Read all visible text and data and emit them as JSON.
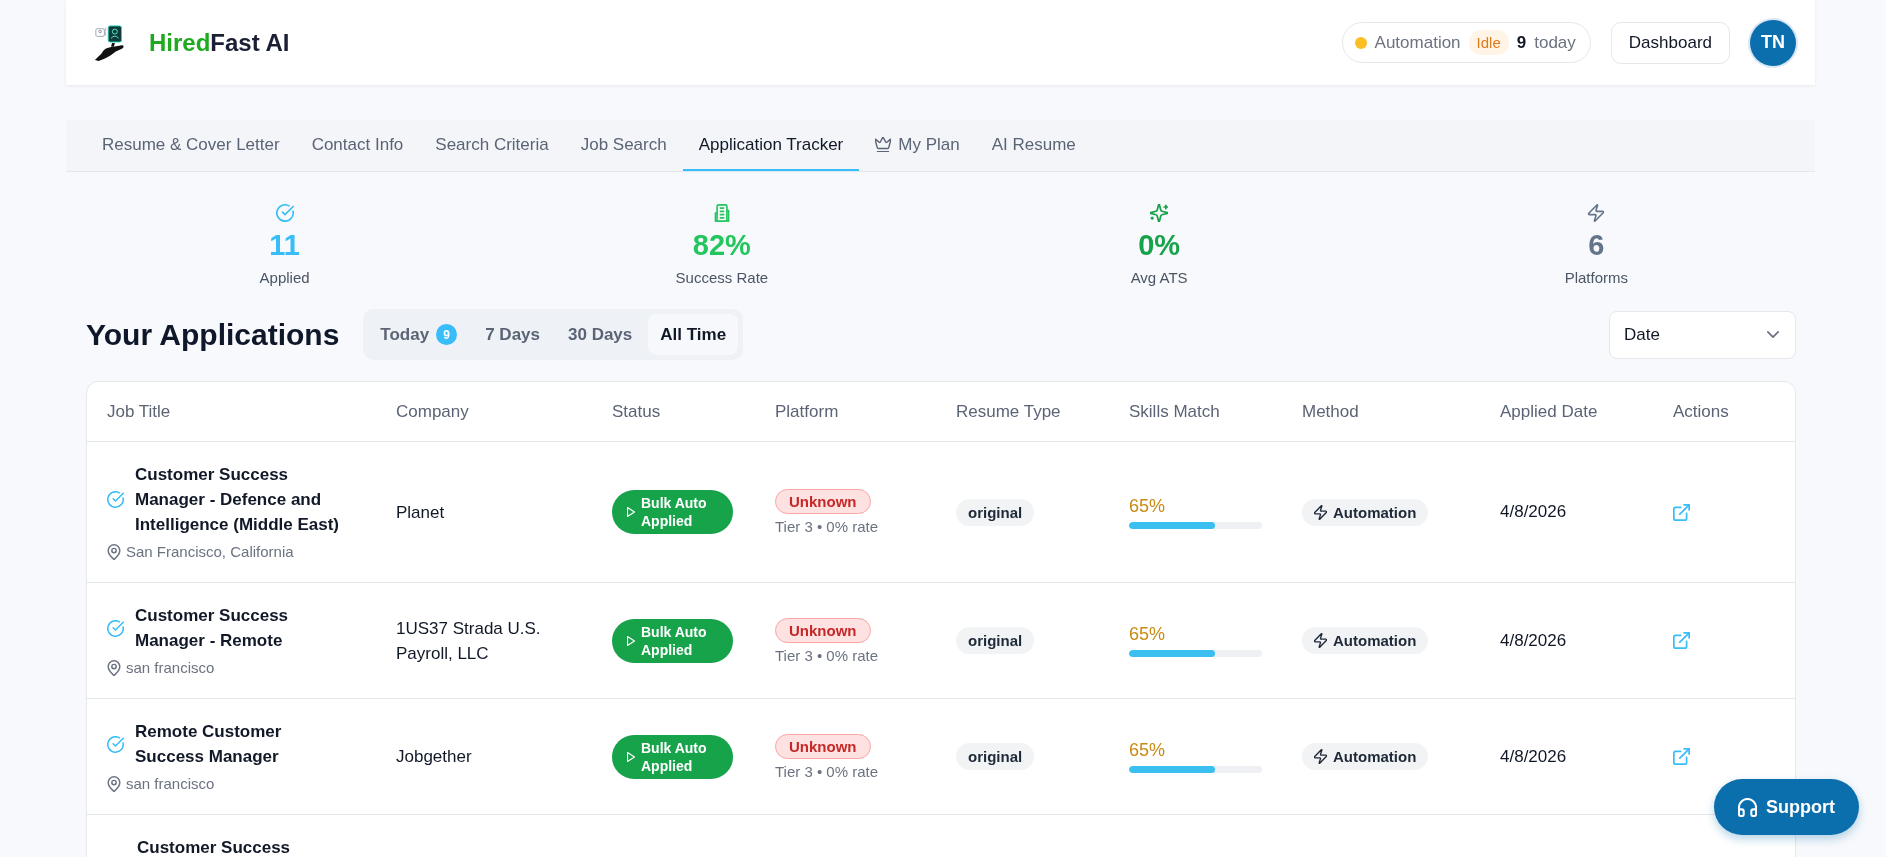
{
  "header": {
    "brand": {
      "lead": "Hired",
      "rest": "Fast AI"
    },
    "automation": {
      "label": "Automation",
      "status": "Idle",
      "count": "9",
      "count_label": "today"
    },
    "dashboard_button": "Dashboard",
    "avatar_initials": "TN"
  },
  "tabs": [
    {
      "label": "Resume & Cover Letter",
      "kind": "plain",
      "selected": false
    },
    {
      "label": "Contact Info",
      "kind": "plain",
      "selected": false
    },
    {
      "label": "Search Criteria",
      "kind": "plain",
      "selected": false
    },
    {
      "label": "Job Search",
      "kind": "plain",
      "selected": false
    },
    {
      "label": "Application Tracker",
      "kind": "plain",
      "selected": true
    },
    {
      "label": "My Plan",
      "kind": "icon",
      "selected": false
    },
    {
      "label": "AI Resume",
      "kind": "plain",
      "selected": false
    }
  ],
  "stats": [
    {
      "value": "11",
      "label": "Applied",
      "color": "#38bdf8"
    },
    {
      "value": "82%",
      "label": "Success Rate",
      "color": "#22c55e"
    },
    {
      "value": "0%",
      "label": "Avg ATS",
      "color": "#16a34a"
    },
    {
      "value": "6",
      "label": "Platforms",
      "color": "#64748b"
    }
  ],
  "applications": {
    "title": "Your Applications",
    "filters": [
      {
        "label": "Today",
        "count": "9",
        "selected": false
      },
      {
        "label": "7 Days",
        "selected": false
      },
      {
        "label": "30 Days",
        "selected": false
      },
      {
        "label": "All Time",
        "selected": true
      }
    ],
    "sort": {
      "value": "Date"
    }
  },
  "table": {
    "columns": [
      "Job Title",
      "Company",
      "Status",
      "Platform",
      "Resume Type",
      "Skills Match",
      "Method",
      "Applied Date",
      "Actions"
    ],
    "rows": [
      {
        "kind": "full",
        "title": "Customer Success Manager - Defence and Intelligence (Middle East)",
        "location": "San Francisco, California",
        "company": "Planet",
        "status": "Bulk Auto Applied",
        "platform": "Unknown",
        "platform_note": "Tier 3 • 0% rate",
        "resume_type": "original",
        "skills_match": "65%",
        "level": 0.65,
        "method": "Automation",
        "applied_date": "4/8/2026"
      },
      {
        "kind": "full",
        "title": "Customer Success Manager - Remote",
        "location": "san francisco",
        "company": "1US37 Strada U.S. Payroll, LLC",
        "status": "Bulk Auto Applied",
        "platform": "Unknown",
        "platform_note": "Tier 3 • 0% rate",
        "resume_type": "original",
        "skills_match": "65%",
        "level": 0.65,
        "method": "Automation",
        "applied_date": "4/8/2026"
      },
      {
        "kind": "full",
        "title": "Remote Customer Success Manager",
        "location": "san francisco",
        "company": "Jobgether",
        "status": "Bulk Auto Applied",
        "platform": "Unknown",
        "platform_note": "Tier 3 • 0% rate",
        "resume_type": "original",
        "skills_match": "65%",
        "level": 0.65,
        "method": "Automation",
        "applied_date": "4/8/2026"
      },
      {
        "kind": "cut",
        "title": "Customer Success"
      }
    ]
  },
  "support_button": "Support"
}
